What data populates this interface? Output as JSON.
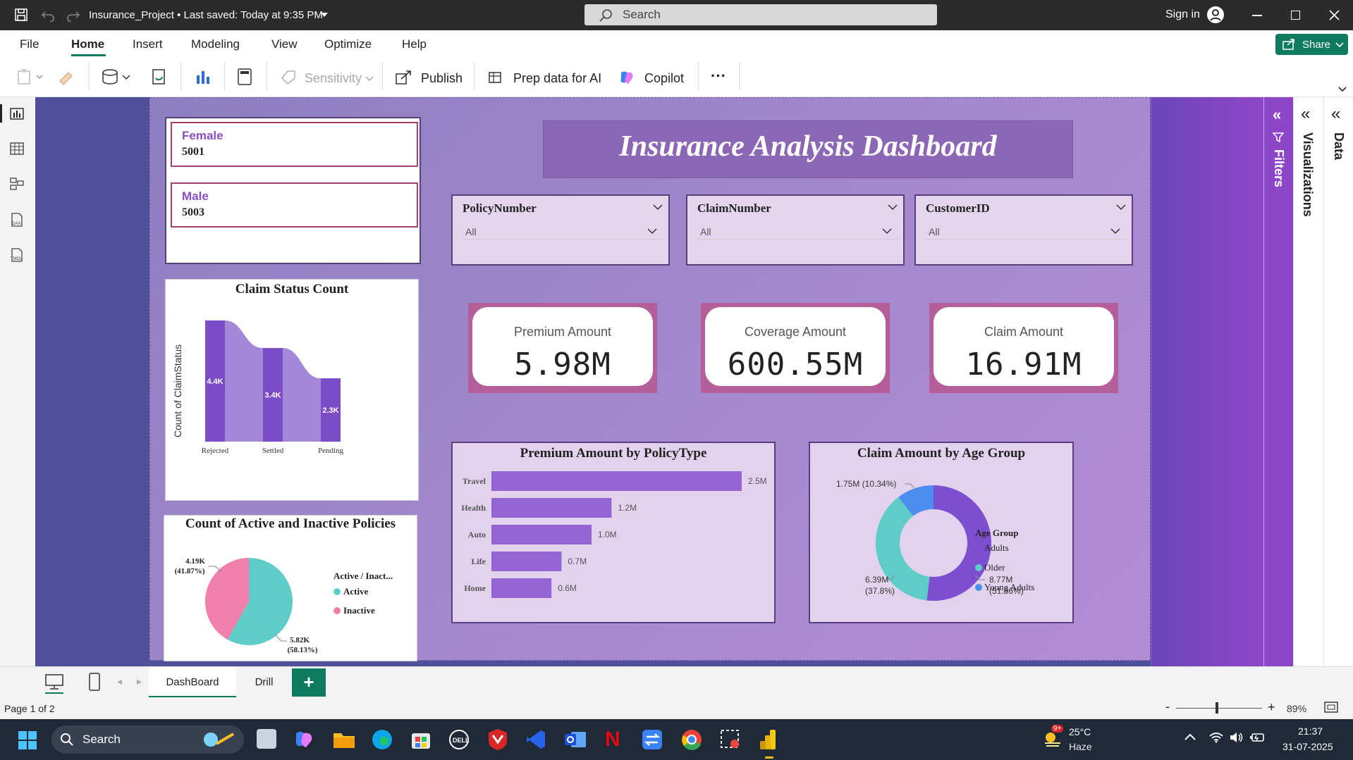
{
  "window": {
    "title": "Insurance_Project • Last saved: Today at 9:35 PM",
    "search_placeholder": "Search",
    "sign_in": "Sign in",
    "share": "Share"
  },
  "menu": [
    "File",
    "Home",
    "Insert",
    "Modeling",
    "View",
    "Optimize",
    "Help"
  ],
  "ribbon": {
    "sensitivity": "Sensitivity",
    "publish": "Publish",
    "prep": "Prep data for AI",
    "copilot": "Copilot",
    "more": "···"
  },
  "dashboard": {
    "title": "Insurance Analysis Dashboard",
    "gender": [
      {
        "label": "Female",
        "value": "5001"
      },
      {
        "label": "Male",
        "value": "5003"
      }
    ],
    "slicers": [
      {
        "label": "PolicyNumber",
        "value": "All"
      },
      {
        "label": "ClaimNumber",
        "value": "All"
      },
      {
        "label": "CustomerID",
        "value": "All"
      }
    ],
    "kpis": [
      {
        "label": "Premium Amount",
        "value": "5.98M"
      },
      {
        "label": "Coverage Amount",
        "value": "600.55M"
      },
      {
        "label": "Claim Amount",
        "value": "16.91M"
      }
    ]
  },
  "panes": {
    "filters": "Filters",
    "visualizations": "Visualizations",
    "data": "Data"
  },
  "tabs": {
    "dashboard": "DashBoard",
    "drill": "Drill",
    "add": "+"
  },
  "status": {
    "page": "Page 1 of 2",
    "zoom": "89%",
    "zoom_value": 0.89
  },
  "taskbar": {
    "search": "Search",
    "weather_temp": "25°C",
    "weather_desc": "Haze",
    "badge": "9+",
    "time": "21:37",
    "date": "31-07-2025"
  },
  "chart_data": [
    {
      "type": "bar",
      "title": "Claim Status Count",
      "ylabel": "Count of ClaimStatus",
      "categories": [
        "Rejected",
        "Settled",
        "Pending"
      ],
      "values": [
        4400,
        3400,
        2300
      ],
      "labels": [
        "4.4K",
        "3.4K",
        "2.3K"
      ],
      "colors": {
        "bar": "#7c4cc8",
        "ribbon": "#a488d8"
      }
    },
    {
      "type": "pie",
      "title": "Count of Active and Inactive Policies",
      "legend_title": "Active / Inact...",
      "legend_position": "right",
      "series": [
        {
          "name": "Active",
          "value": 5820,
          "label": "5.82K",
          "pct": "(58.13%)",
          "color": "#5ecdc8"
        },
        {
          "name": "Inactive",
          "value": 4190,
          "label": "4.19K",
          "pct": "(41.87%)",
          "color": "#f07fac"
        }
      ]
    },
    {
      "type": "bar",
      "orientation": "horizontal",
      "title": "Premium Amount by PolicyType",
      "categories": [
        "Travel",
        "Health",
        "Auto",
        "Life",
        "Home"
      ],
      "values": [
        2.5,
        1.2,
        1.0,
        0.7,
        0.6
      ],
      "labels": [
        "2.5M",
        "1.2M",
        "1.0M",
        "0.7M",
        "0.6M"
      ],
      "colors": {
        "bar": "#9565d4"
      }
    },
    {
      "type": "pie",
      "subtype": "donut",
      "title": "Claim Amount by Age Group",
      "legend_title": "Age Group",
      "legend_position": "right",
      "series": [
        {
          "name": "Adults",
          "value": 8.77,
          "label": "8.77M",
          "pct": "(51.86%)",
          "color": "#7e4ed1"
        },
        {
          "name": "Older",
          "value": 6.39,
          "label": "6.39M",
          "pct": "(37.8%)",
          "color": "#5ecdc8"
        },
        {
          "name": "Young Adults",
          "value": 1.75,
          "label": "1.75M (10.34%)",
          "pct": "",
          "color": "#4a8ff0"
        }
      ]
    }
  ]
}
